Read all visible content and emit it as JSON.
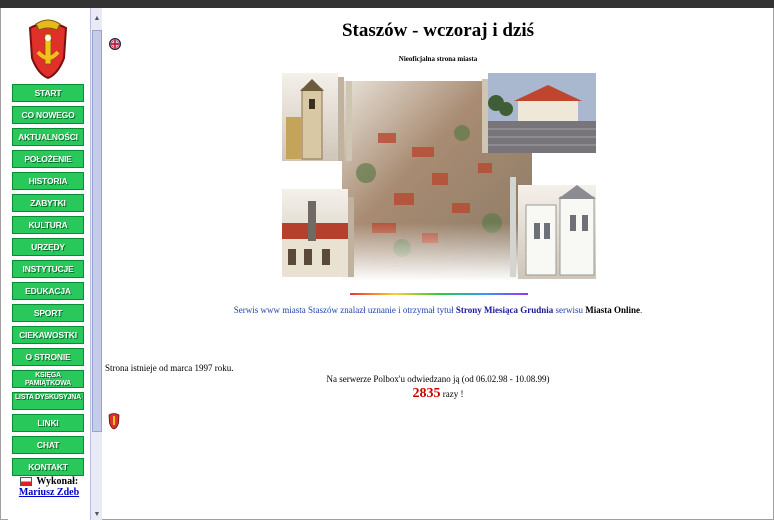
{
  "header": {
    "title": "Staszów - wczoraj i dziś",
    "subtitle": "Nieoficjalna strona miasta"
  },
  "menu": [
    "START",
    "CO NOWEGO",
    "AKTUALNOŚCI",
    "POŁOŻENIE",
    "HISTORIA",
    "ZABYTKI",
    "KULTURA",
    "URZĘDY",
    "INSTYTUCJE",
    "EDUKACJA",
    "SPORT",
    "CIEKAWOSTKI",
    "O STRONIE",
    "KSIĘGA PAMIĄTKOWA",
    "LISTA DYSKUSYJNA",
    "LINKI",
    "CHAT",
    "KONTAKT"
  ],
  "author": {
    "label": "Wykonał:",
    "name": "Mariusz Zdeb"
  },
  "award": {
    "prefix": "Serwis www miasta Staszów znalazł uznanie i otrzymał tytuł",
    "title": "Strony Miesiąca Grudnia",
    "middle": "serwisu",
    "site": "Miasta Online",
    "suffix": "."
  },
  "footer": {
    "since": "Strona istnieje od marca 1997 roku.",
    "visits": "Na serwerze Polbox'u odwiedzano ją (od 06.02.98 - 10.08.99)",
    "count": "2835",
    "count_suffix": "razy !"
  },
  "colors": {
    "menu_green": "#28c85a",
    "counter_red": "#cc0000",
    "award_blue": "#2244aa"
  }
}
